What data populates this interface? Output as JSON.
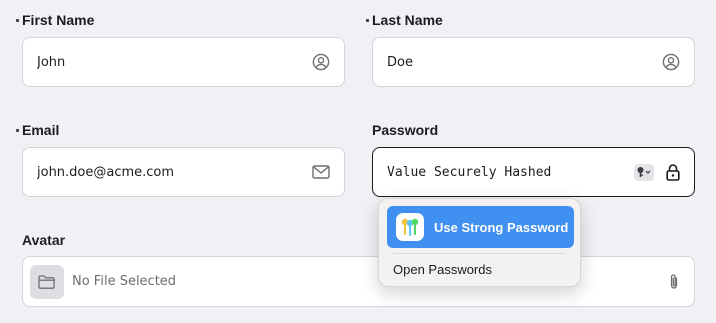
{
  "form": {
    "first_name": {
      "label": "First Name",
      "value": "John",
      "icon": "person-circle-icon"
    },
    "last_name": {
      "label": "Last Name",
      "value": "Doe",
      "icon": "person-circle-icon"
    },
    "email": {
      "label": "Email",
      "value": "john.doe@acme.com",
      "icon": "envelope-icon"
    },
    "password": {
      "label": "Password",
      "value": "Value Securely Hashed",
      "icons": [
        "key-icon",
        "lock-icon"
      ]
    },
    "avatar": {
      "label": "Avatar",
      "placeholder": "No File Selected",
      "icons": [
        "folder-icon",
        "paperclip-icon"
      ]
    }
  },
  "password_popover": {
    "use_strong_label": "Use Strong Password",
    "open_passwords_label": "Open Passwords"
  },
  "colors": {
    "background": "#f1f0f5",
    "accent": "#3f90f0",
    "field_border": "#d5d4da"
  }
}
